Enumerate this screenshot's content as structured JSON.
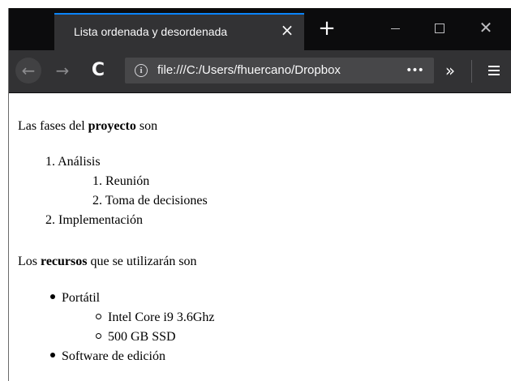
{
  "browser": {
    "tab_title": "Lista ordenada y desordenada",
    "tab_close_icon": "×",
    "new_tab_icon": "+",
    "url": "file:///C:/Users/fhuercano/Dropbox",
    "page_actions_icon": "•••",
    "overflow_icon": "»",
    "back_icon": "←",
    "forward_icon": "→",
    "reload_icon": "C",
    "info_icon": "i",
    "window_close_icon": "✕",
    "accent_color": "#0a84ff"
  },
  "page": {
    "intro1_before": "Las fases del ",
    "intro1_bold": "proyecto",
    "intro1_after": " son",
    "ordered_list": [
      {
        "number": "1.",
        "label": "Análisis",
        "children": [
          {
            "number": "1.",
            "label": "Reunión"
          },
          {
            "number": "2.",
            "label": "Toma de decisiones"
          }
        ]
      },
      {
        "number": "2.",
        "label": "Implementación"
      }
    ],
    "intro2_before": "Los ",
    "intro2_bold": "recursos",
    "intro2_after": " que se utilizarán son",
    "unordered_list": [
      {
        "label": "Portátil",
        "children": [
          {
            "label": "Intel Core i9 3.6Ghz"
          },
          {
            "label": "500 GB SSD"
          }
        ]
      },
      {
        "label": "Software de edición"
      }
    ]
  }
}
